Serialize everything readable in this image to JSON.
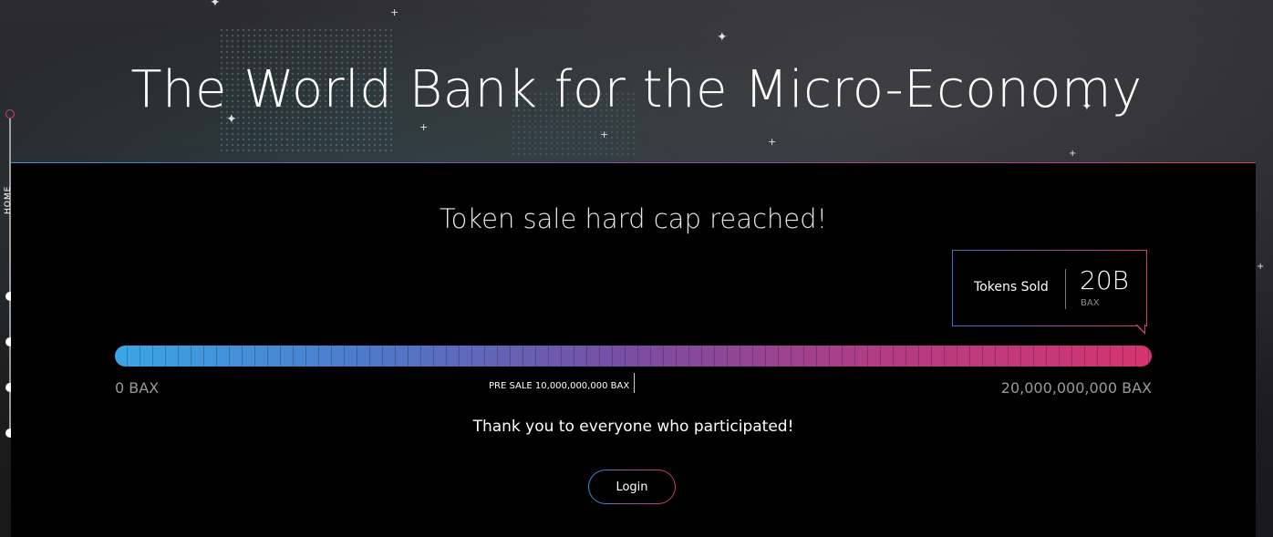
{
  "hero": {
    "title": "The World Bank for the Micro-Economy"
  },
  "side_nav": {
    "label": "HOME",
    "dots": 4
  },
  "token_sale": {
    "heading": "Token sale hard cap reached!",
    "sold": {
      "label": "Tokens Sold",
      "value": "20B",
      "unit": "BAX"
    },
    "progress": {
      "fraction": 1.0,
      "presale_fraction": 0.5,
      "min_label": "0 BAX",
      "max_label": "20,000,000,000 BAX",
      "presale_label": "PRE SALE 10,000,000,000 BAX"
    },
    "thanks": "Thank you to everyone who participated!",
    "login_label": "Login"
  },
  "colors": {
    "gradient_start": "#3aa6e6",
    "gradient_mid": "#7a4da2",
    "gradient_end": "#d3356f",
    "panel_bg": "#000000"
  }
}
